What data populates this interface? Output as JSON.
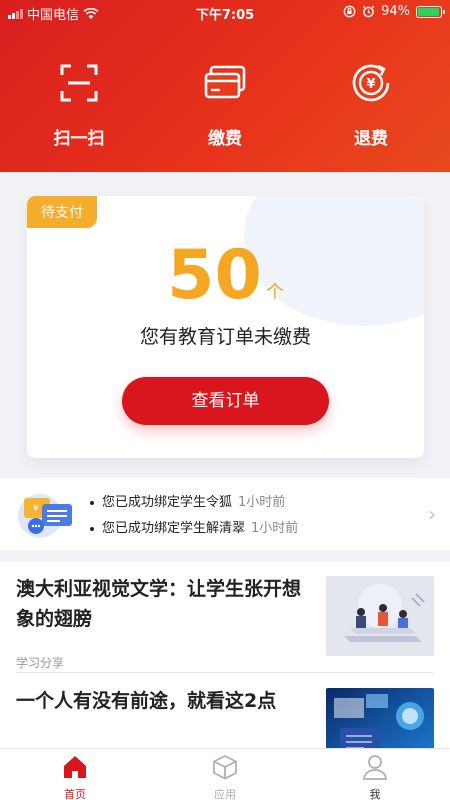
{
  "status_bar": {
    "carrier": "中国电信",
    "time": "下午7:05",
    "battery_percent": "94%",
    "battery_level": 0.94
  },
  "quick_actions": [
    {
      "label": "扫一扫",
      "icon": "scan-icon"
    },
    {
      "label": "缴费",
      "icon": "card-icon"
    },
    {
      "label": "退费",
      "icon": "refund-icon"
    }
  ],
  "pending": {
    "tag": "待支付",
    "count": "50",
    "unit": "个",
    "description": "您有教育订单未缴费",
    "button_label": "查看订单"
  },
  "notices": [
    {
      "text": "您已成功绑定学生令狐",
      "time": "1小时前"
    },
    {
      "text": "您已成功绑定学生解清翠",
      "time": "1小时前"
    }
  ],
  "articles": [
    {
      "title": "澳大利亚视觉文学：让学生张开想象的翅膀",
      "category": "学习分享"
    },
    {
      "title": "一个人有没有前途，就看这2点",
      "category": ""
    }
  ],
  "tabs": [
    {
      "label": "首页",
      "icon": "home-icon",
      "active": true
    },
    {
      "label": "应用",
      "icon": "cube-icon",
      "active": false
    },
    {
      "label": "我",
      "icon": "person-icon",
      "active": false
    }
  ],
  "colors": {
    "brand_red": "#d9161d",
    "accent_orange": "#f5a623",
    "battery_green": "#2fd158"
  }
}
